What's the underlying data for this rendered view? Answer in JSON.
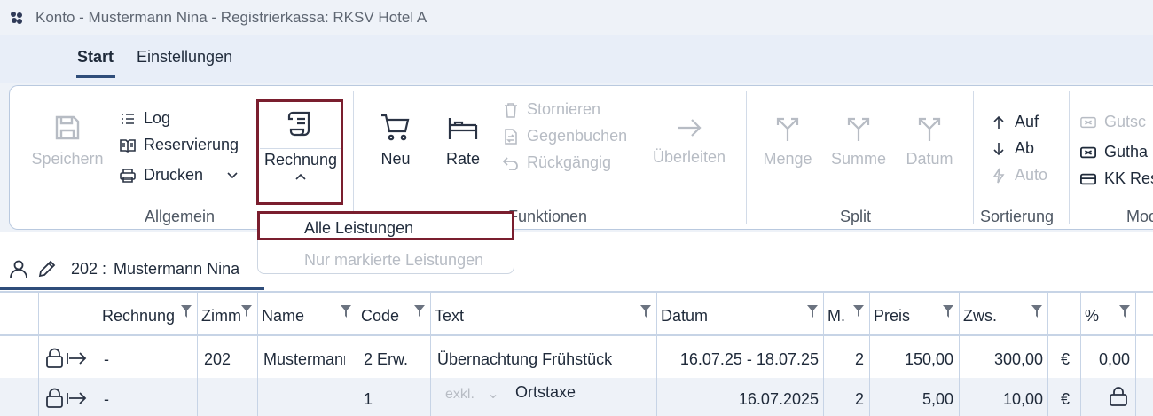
{
  "window": {
    "title": "Konto - Mustermann Nina - Registrierkassa: RKSV Hotel A"
  },
  "tabs": [
    {
      "label": "Start"
    },
    {
      "label": "Einstellungen"
    }
  ],
  "ribbon": {
    "allgemein": {
      "label": "Allgemein",
      "save": "Speichern",
      "log": "Log",
      "reservierung": "Reservierung",
      "drucken": "Drucken",
      "rechnung": "Rechnung"
    },
    "funktionen": {
      "label": "Funktionen",
      "neu": "Neu",
      "rate": "Rate",
      "stornieren": "Stornieren",
      "gegenbuchen": "Gegenbuchen",
      "rueckgaengig": "Rückgängig",
      "ueberleiten": "Überleiten"
    },
    "split": {
      "label": "Split",
      "menge": "Menge",
      "summe": "Summe",
      "datum": "Datum"
    },
    "sortierung": {
      "label": "Sortierung",
      "auf": "Auf",
      "ab": "Ab",
      "auto": "Auto"
    },
    "mod": {
      "label": "Mod",
      "gutsc": "Gutsc",
      "gutha": "Gutha",
      "kkres": "KK Res"
    }
  },
  "dropdown": {
    "alle": "Alle Leistungen",
    "markierte": "Nur markierte Leistungen"
  },
  "customer": {
    "room": "202 :",
    "name": "Mustermann Nina"
  },
  "table": {
    "headers": [
      "Rechnung",
      "Zimm",
      "Name",
      "Code",
      "Text",
      "Datum",
      "M.",
      "Preis",
      "Zws.",
      "%"
    ],
    "rows": [
      {
        "rechnung": "-",
        "zimmer": "202",
        "name": "Mustermann",
        "code": "2 Erw.",
        "text": "Übernachtung Frühstück",
        "datum": "16.07.25 - 18.07.25",
        "menge": "2",
        "preis": "150,00",
        "zws": "300,00",
        "currency": "€",
        "pct": "0,00"
      },
      {
        "rechnung": "-",
        "zimmer": "",
        "name": "",
        "code": "1",
        "text_hint": "exkl.",
        "text": "Ortstaxe",
        "datum": "16.07.2025",
        "menge": "2",
        "preis": "5,00",
        "zws": "10,00",
        "currency": "€",
        "pct": ""
      }
    ]
  },
  "colors": {
    "accent": "#2f4d7a",
    "highlight": "#7a1e2e",
    "disabled": "#b7bcc4"
  }
}
